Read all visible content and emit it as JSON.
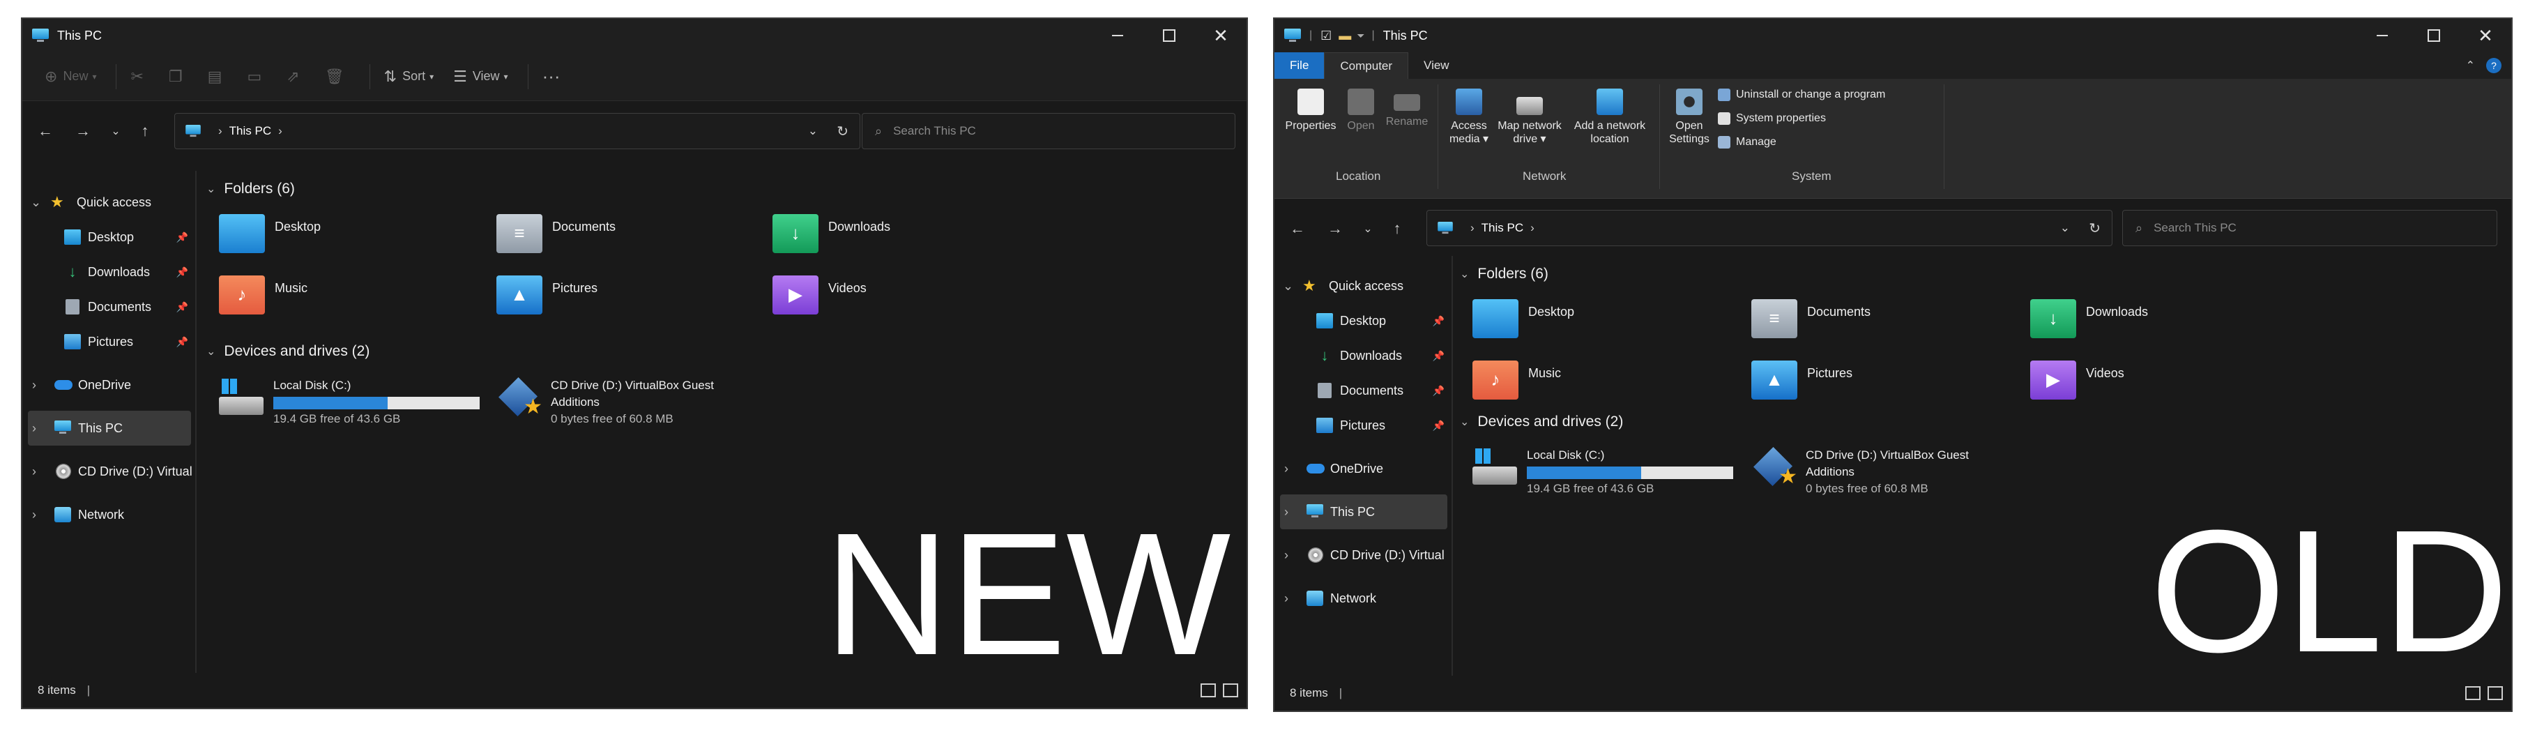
{
  "new": {
    "title": "This PC",
    "toolbar": {
      "new": "New",
      "sort": "Sort",
      "view": "View"
    },
    "address": "This PC",
    "search_placeholder": "Search This PC",
    "sidebar": {
      "quick_access": "Quick access",
      "desktop": "Desktop",
      "downloads": "Downloads",
      "documents": "Documents",
      "pictures": "Pictures",
      "onedrive": "OneDrive",
      "this_pc": "This PC",
      "cd_drive": "CD Drive (D:) Virtual",
      "network": "Network"
    },
    "folders_header": "Folders (6)",
    "folders": [
      "Desktop",
      "Documents",
      "Downloads",
      "Music",
      "Pictures",
      "Videos"
    ],
    "drives_header": "Devices and drives (2)",
    "drive_c": {
      "name": "Local Disk (C:)",
      "free": "19.4 GB free of 43.6 GB",
      "used_fraction": 0.555
    },
    "drive_d": {
      "name_line1": "CD Drive (D:) VirtualBox Guest",
      "name_line2": "Additions",
      "free": "0 bytes free of 60.8 MB"
    },
    "status": "8 items",
    "label": "NEW"
  },
  "old": {
    "title": "This PC",
    "tabs": {
      "file": "File",
      "computer": "Computer",
      "view": "View"
    },
    "ribbon": {
      "properties": "Properties",
      "open": "Open",
      "rename": "Rename",
      "access_media_1": "Access",
      "access_media_2": "media",
      "map_drive_1": "Map network",
      "map_drive_2": "drive",
      "add_location_1": "Add a network",
      "add_location_2": "location",
      "open_settings_1": "Open",
      "open_settings_2": "Settings",
      "uninstall": "Uninstall or change a program",
      "system_properties": "System properties",
      "manage": "Manage",
      "group_location": "Location",
      "group_network": "Network",
      "group_system": "System"
    },
    "address": "This PC",
    "search_placeholder": "Search This PC",
    "sidebar": {
      "quick_access": "Quick access",
      "desktop": "Desktop",
      "downloads": "Downloads",
      "documents": "Documents",
      "pictures": "Pictures",
      "onedrive": "OneDrive",
      "this_pc": "This PC",
      "cd_drive": "CD Drive (D:) Virtual",
      "network": "Network"
    },
    "folders_header": "Folders (6)",
    "folders": [
      "Desktop",
      "Documents",
      "Downloads",
      "Music",
      "Pictures",
      "Videos"
    ],
    "drives_header": "Devices and drives (2)",
    "drive_c": {
      "name": "Local Disk (C:)",
      "free": "19.4 GB free of 43.6 GB",
      "used_fraction": 0.555
    },
    "drive_d": {
      "name_line1": "CD Drive (D:) VirtualBox Guest",
      "name_line2": "Additions",
      "free": "0 bytes free of 60.8 MB"
    },
    "status": "8 items",
    "label": "OLD"
  },
  "colors": {
    "window_bg": "#191919",
    "accent": "#1b6ec2",
    "bar_fill": "#2a86d8"
  }
}
